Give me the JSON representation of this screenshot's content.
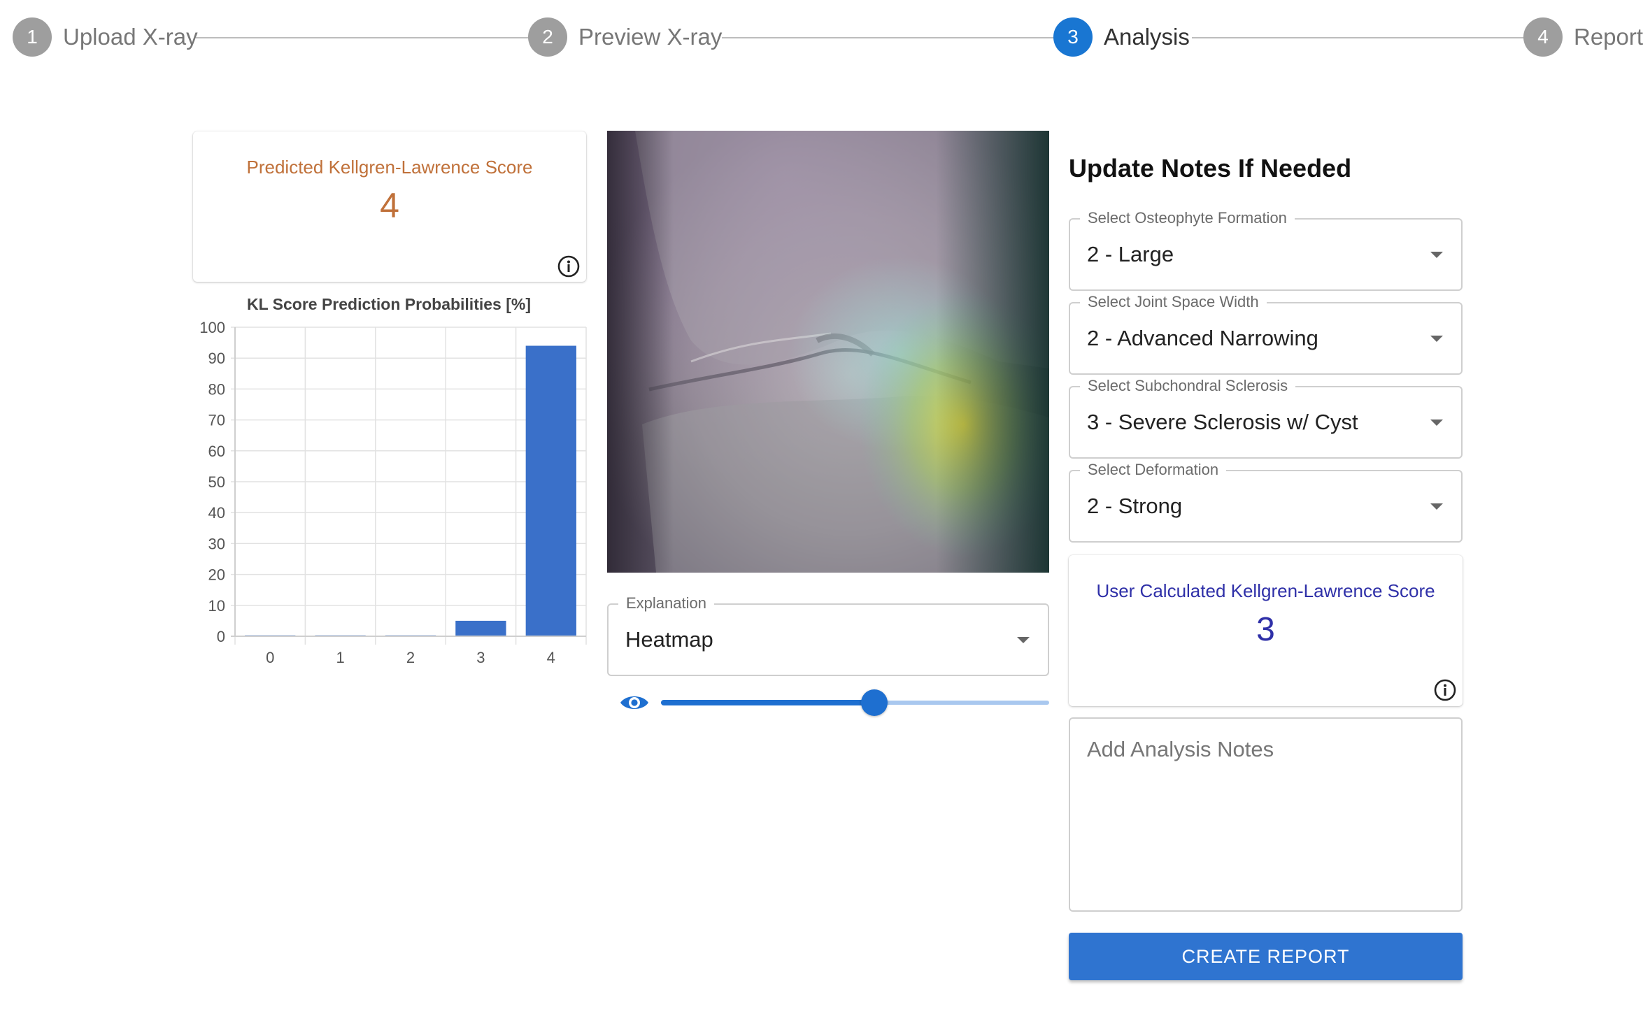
{
  "stepper": {
    "steps": [
      {
        "number": "1",
        "label": "Upload X-ray",
        "state": "inactive"
      },
      {
        "number": "2",
        "label": "Preview X-ray",
        "state": "inactive"
      },
      {
        "number": "3",
        "label": "Analysis",
        "state": "active"
      },
      {
        "number": "4",
        "label": "Report",
        "state": "inactive"
      }
    ]
  },
  "prediction": {
    "title": "Predicted Kellgren-Lawrence Score",
    "value": "4"
  },
  "chart_data": {
    "type": "bar",
    "title": "KL Score Prediction Probabilities [%]",
    "categories": [
      "0",
      "1",
      "2",
      "3",
      "4"
    ],
    "values": [
      0.3,
      0.3,
      0.3,
      5,
      94
    ],
    "ylim": [
      0,
      100
    ],
    "yticks": [
      "0",
      "10",
      "20",
      "30",
      "40",
      "50",
      "60",
      "70",
      "80",
      "90",
      "100"
    ],
    "xlabel": "",
    "ylabel": "",
    "grid": true,
    "bar_color": "#3a70c9"
  },
  "explanation": {
    "legend": "Explanation",
    "value": "Heatmap",
    "overlay_opacity": 0.55
  },
  "notes": {
    "heading": "Update Notes If Needed",
    "osteophyte": {
      "legend": "Select Osteophyte Formation",
      "value": "2 - Large"
    },
    "joint_space": {
      "legend": "Select Joint Space Width",
      "value": "2 - Advanced Narrowing"
    },
    "sclerosis": {
      "legend": "Select Subchondral Sclerosis",
      "value": "3 - Severe Sclerosis w/ Cyst"
    },
    "deformation": {
      "legend": "Select Deformation",
      "value": "2 - Strong"
    },
    "user_score": {
      "title": "User Calculated Kellgren-Lawrence Score",
      "value": "3"
    },
    "analysis_placeholder": "Add Analysis Notes",
    "create_button": "CREATE REPORT"
  },
  "colors": {
    "accent": "#1976d2",
    "predicted_score": "#c0713a",
    "user_score": "#2f30a8",
    "button": "#2f74d0"
  }
}
